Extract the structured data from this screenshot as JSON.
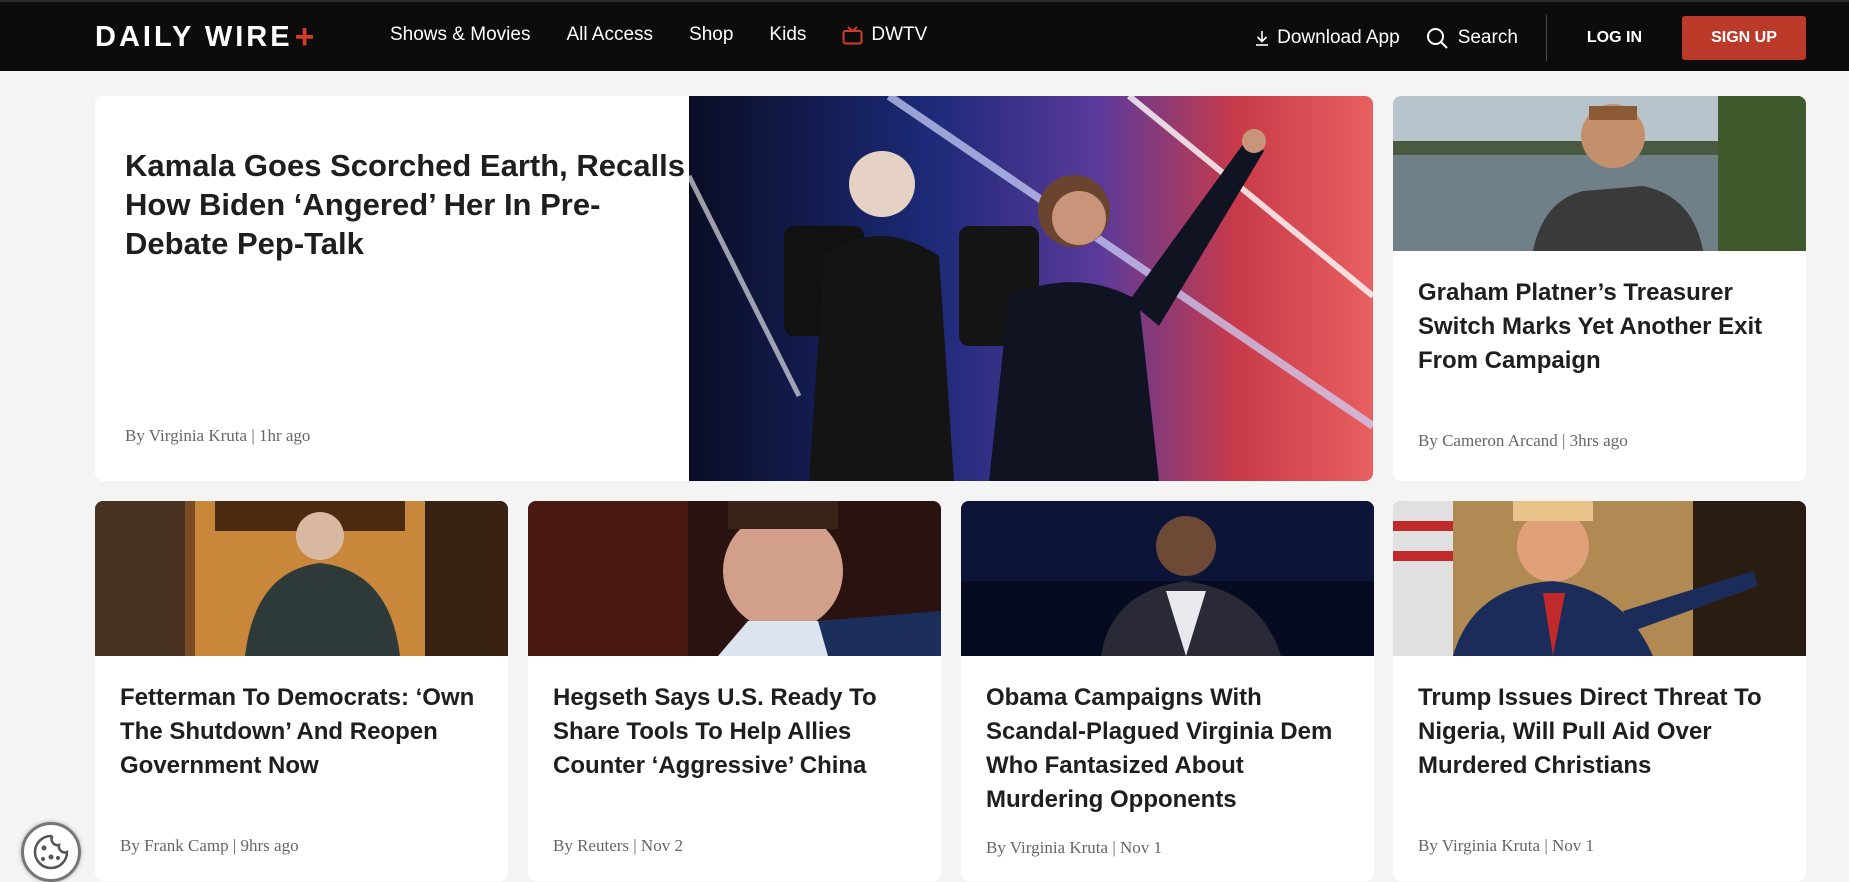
{
  "header": {
    "logo_text": "DAILY WIRE",
    "logo_plus": "+",
    "nav": [
      "Shows & Movies",
      "All Access",
      "Shop",
      "Kids",
      "DWTV"
    ],
    "download_label": "Download App",
    "search_label": "Search",
    "login_label": "LOG IN",
    "signup_label": "SIGN UP",
    "accent_color": "#bb3a2a"
  },
  "hero": {
    "title": "Kamala Goes Scorched Earth, Recalls How Biden ‘Angered’ Her In Pre-Debate Pep-Talk",
    "byline": "By Virginia Kruta | 1hr ago"
  },
  "side": {
    "title": "Graham Platner’s Treasurer Switch Marks Yet Another Exit From Campaign",
    "byline": "By Cameron Arcand | 3hrs ago"
  },
  "cards": [
    {
      "title": "Fetterman To Democrats: ‘Own The Shutdown’ And Reopen Government Now",
      "byline": "By Frank Camp | 9hrs ago"
    },
    {
      "title": "Hegseth Says U.S. Ready To Share Tools To Help Allies Counter ‘Aggressive’ China",
      "byline": "By Reuters | Nov 2"
    },
    {
      "title": "Obama Campaigns With Scandal-Plagued Virginia Dem Who Fantasized About Murdering Opponents",
      "byline": "By Virginia Kruta | Nov 1"
    },
    {
      "title": "Trump Issues Direct Threat To Nigeria, Will Pull Aid Over Murdered Christians",
      "byline": "By Virginia Kruta | Nov 1"
    }
  ]
}
